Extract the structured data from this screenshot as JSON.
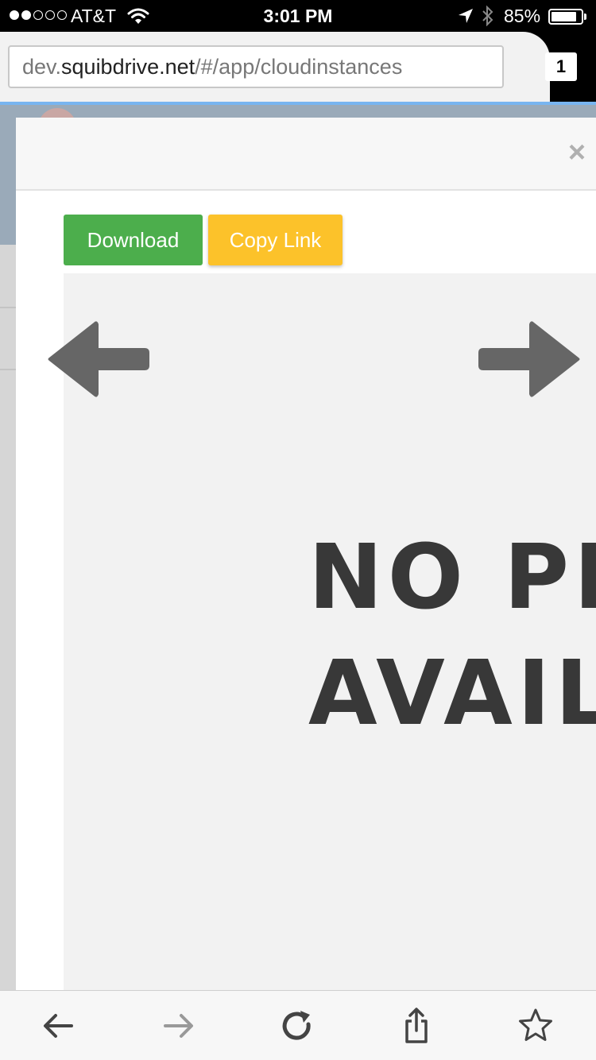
{
  "status_bar": {
    "carrier": "AT&T",
    "time": "3:01 PM",
    "battery_percent": "85%",
    "battery_level": 0.85,
    "signal_bars": 2,
    "signal_total": 5
  },
  "browser": {
    "url_prefix": "dev.",
    "url_domain": "squibdrive.net",
    "url_path": "/#/app/cloudinstances",
    "tab_count": "1"
  },
  "modal": {
    "close_label": "×",
    "download_label": "Download",
    "copy_link_label": "Copy Link",
    "preview_line1": "NO PREVIEW",
    "preview_line2": "AVAILABLE"
  },
  "toolbar": {
    "icons": [
      "back-icon",
      "forward-icon",
      "reload-icon",
      "share-icon",
      "bookmark-star-icon"
    ]
  },
  "colors": {
    "download": "#4cae4c",
    "copy_link": "#fcc22a",
    "preview_bg": "#f2f2f2",
    "arrow": "#666666"
  }
}
